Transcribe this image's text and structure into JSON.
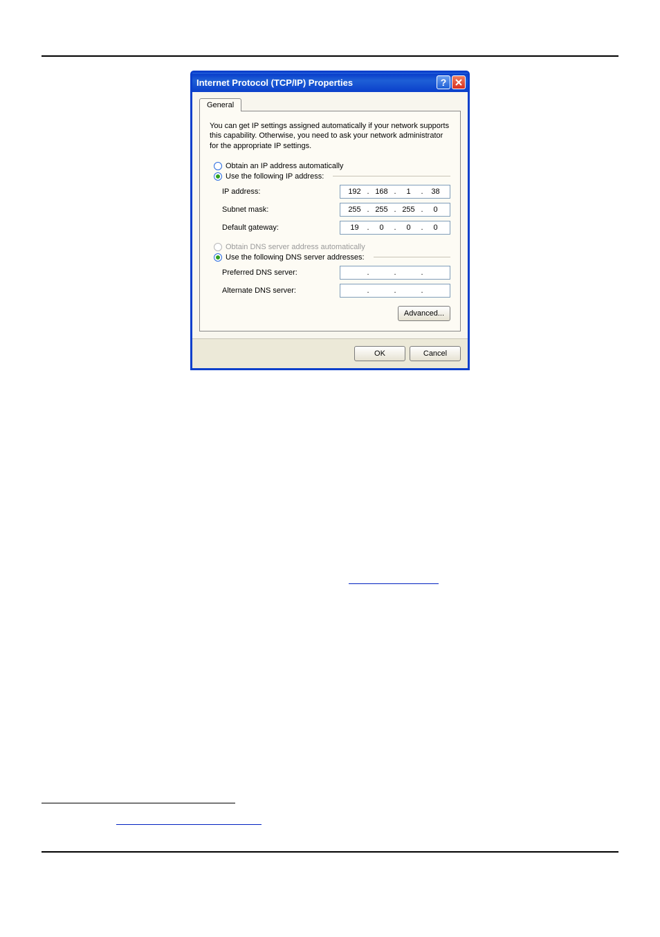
{
  "dialog": {
    "title": "Internet Protocol (TCP/IP) Properties",
    "tab": "General",
    "description": "You can get IP settings assigned automatically if your network supports this capability. Otherwise, you need to ask your network administrator for the appropriate IP settings.",
    "radio_ip_auto": "Obtain an IP address automatically",
    "radio_ip_manual": "Use the following IP address:",
    "fields": {
      "ip_label": "IP address:",
      "subnet_label": "Subnet mask:",
      "gateway_label": "Default gateway:",
      "ip": [
        "192",
        "168",
        "1",
        "38"
      ],
      "subnet": [
        "255",
        "255",
        "255",
        "0"
      ],
      "gateway": [
        "19",
        "0",
        "0",
        "0"
      ]
    },
    "radio_dns_auto": "Obtain DNS server address automatically",
    "radio_dns_manual": "Use the following DNS server addresses:",
    "dns": {
      "preferred_label": "Preferred DNS server:",
      "alternate_label": "Alternate DNS server:",
      "preferred": [
        "",
        "",
        "",
        ""
      ],
      "alternate": [
        "",
        "",
        "",
        ""
      ]
    },
    "advanced": "Advanced...",
    "ok": "OK",
    "cancel": "Cancel"
  }
}
